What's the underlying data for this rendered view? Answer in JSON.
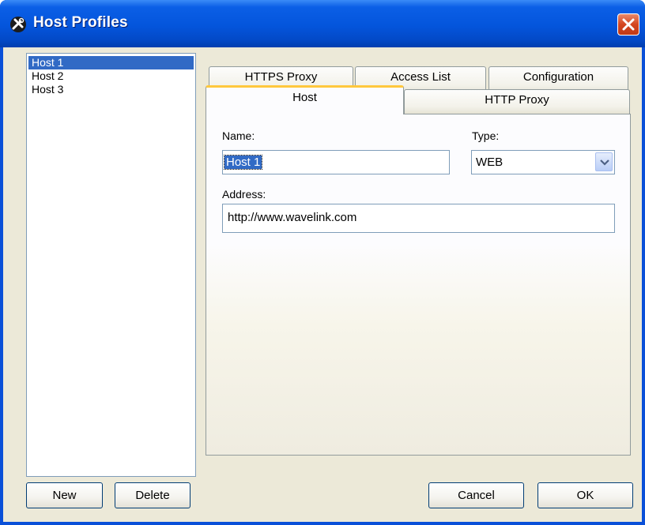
{
  "window": {
    "title": "Host Profiles"
  },
  "hosts": [
    "Host 1",
    "Host 2",
    "Host 3"
  ],
  "tabs": {
    "back_row": [
      "HTTPS Proxy",
      "Access List",
      "Configuration"
    ],
    "front_row": [
      "Host",
      "HTTP Proxy"
    ],
    "active": "Host"
  },
  "form": {
    "name_label": "Name:",
    "name_value": "Host 1",
    "type_label": "Type:",
    "type_value": "WEB",
    "address_label": "Address:",
    "address_value": "http://www.wavelink.com"
  },
  "buttons": {
    "new": "New",
    "delete": "Delete",
    "cancel": "Cancel",
    "ok": "OK"
  },
  "icons": {
    "app": "tools-icon",
    "close": "close-icon",
    "dropdown": "chevron-down-icon"
  },
  "colors": {
    "titlebar": "#0455dc",
    "face": "#ece9d8",
    "selection": "#316ac5",
    "close": "#d4451f",
    "active_tab_accent": "#ffc83c"
  }
}
